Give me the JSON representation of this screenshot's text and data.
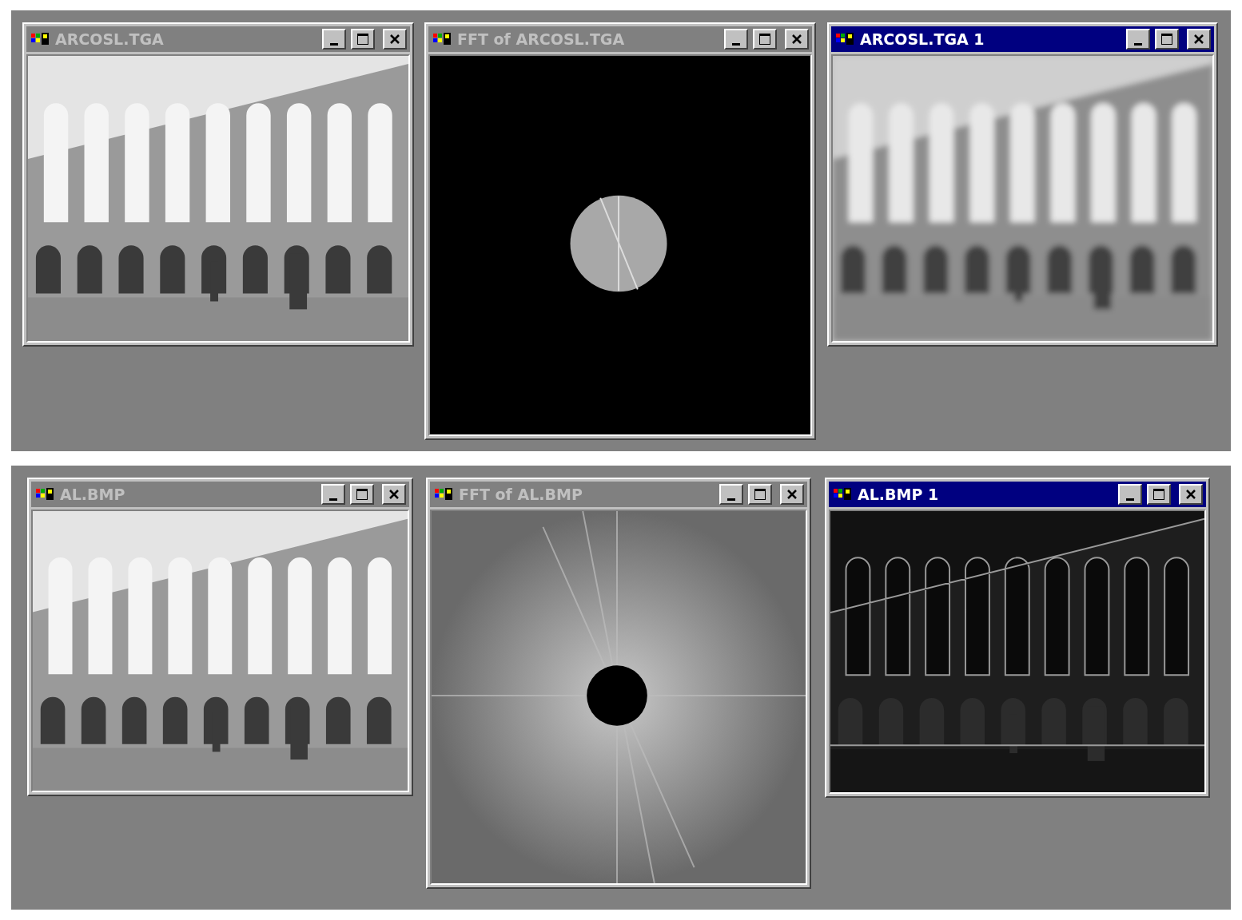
{
  "panels": [
    {
      "windows": [
        {
          "title": "ARCOSL.TGA",
          "active": false
        },
        {
          "title": "FFT of ARCOSL.TGA",
          "active": false,
          "kind": "lowpass"
        },
        {
          "title": "ARCOSL.TGA 1",
          "active": true,
          "kind": "blur"
        }
      ]
    },
    {
      "windows": [
        {
          "title": "AL.BMP",
          "active": false
        },
        {
          "title": "FFT of AL.BMP",
          "active": false,
          "kind": "highpass"
        },
        {
          "title": "AL.BMP 1",
          "active": true,
          "kind": "edges"
        }
      ]
    }
  ]
}
